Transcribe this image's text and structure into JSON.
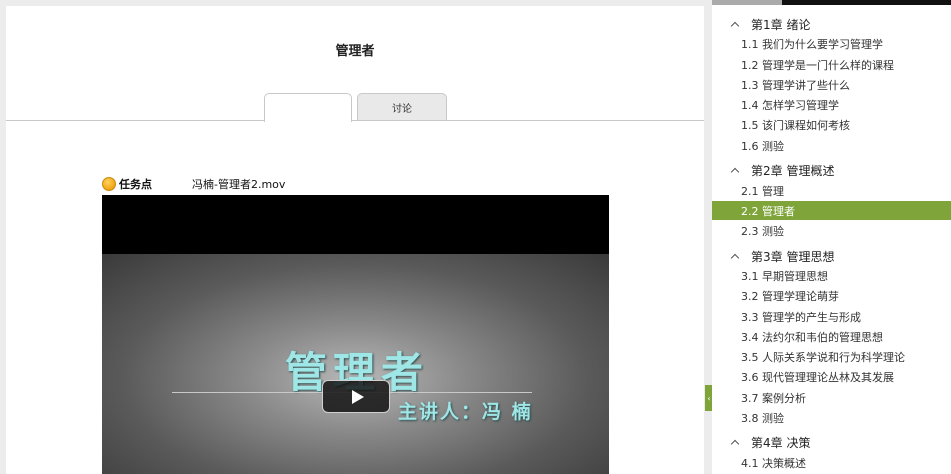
{
  "main": {
    "title": "管理者",
    "tabs": [
      {
        "label": ""
      },
      {
        "label": "讨论"
      }
    ],
    "task": {
      "label": "任务点",
      "file_name": "冯楠-管理者2.mov"
    },
    "video": {
      "title": "管理者",
      "speaker": "主讲人：冯  楠"
    }
  },
  "sidebar": {
    "chapters": [
      {
        "title": "第1章 绪论",
        "lessons": [
          {
            "label": "1.1 我们为什么要学习管理学"
          },
          {
            "label": "1.2 管理学是一门什么样的课程"
          },
          {
            "label": "1.3 管理学讲了些什么"
          },
          {
            "label": "1.4 怎样学习管理学"
          },
          {
            "label": "1.5 该门课程如何考核"
          },
          {
            "label": "1.6 测验"
          }
        ]
      },
      {
        "title": "第2章 管理概述",
        "lessons": [
          {
            "label": "2.1 管理"
          },
          {
            "label": "2.2 管理者",
            "active": true
          },
          {
            "label": "2.3 测验"
          }
        ]
      },
      {
        "title": "第3章 管理思想",
        "lessons": [
          {
            "label": "3.1 早期管理思想"
          },
          {
            "label": "3.2 管理学理论萌芽"
          },
          {
            "label": "3.3 管理学的产生与形成"
          },
          {
            "label": "3.4 法约尔和韦伯的管理思想"
          },
          {
            "label": "3.5 人际关系学说和行为科学理论"
          },
          {
            "label": "3.6 现代管理理论丛林及其发展"
          },
          {
            "label": "3.7 案例分析"
          },
          {
            "label": "3.8 测验"
          }
        ]
      },
      {
        "title": "第4章 决策",
        "lessons": [
          {
            "label": "4.1 决策概述"
          }
        ]
      }
    ]
  },
  "colors": {
    "accent": "#7ea43a",
    "video_text": "#9fe6e6",
    "task_dot": "#f0a313"
  }
}
